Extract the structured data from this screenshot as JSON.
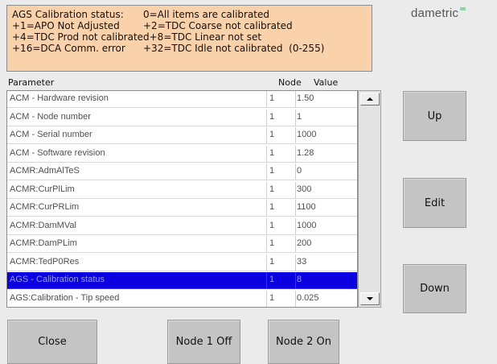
{
  "status_box": {
    "lines": [
      [
        "AGS Calibration status:",
        "0=All items are calibrated"
      ],
      [
        "+1=APO Not Adjusted",
        "+2=TDC Coarse not calibrated"
      ],
      [
        "+4=TDC Prod not calibrated",
        "  +8=TDC Linear not set"
      ],
      [
        "+16=DCA Comm. error",
        "+32=TDC Idle not calibrated  (0-255)"
      ]
    ]
  },
  "logo": {
    "text": "dametric"
  },
  "table": {
    "headers": {
      "parameter": "Parameter",
      "node": "Node",
      "value": "Value"
    },
    "selected_index": 10,
    "rows": [
      {
        "parameter": "ACM - Hardware revision",
        "node": "1",
        "value": "1.50"
      },
      {
        "parameter": "ACM - Node number",
        "node": "1",
        "value": "1"
      },
      {
        "parameter": "ACM - Serial number",
        "node": "1",
        "value": "1000"
      },
      {
        "parameter": "ACM - Software revision",
        "node": "1",
        "value": "1.28"
      },
      {
        "parameter": "ACMR:AdmAlTeS",
        "node": "1",
        "value": "0"
      },
      {
        "parameter": "ACMR:CurPlLim",
        "node": "1",
        "value": "300"
      },
      {
        "parameter": "ACMR:CurPRLim",
        "node": "1",
        "value": "1100"
      },
      {
        "parameter": "ACMR:DamMVal",
        "node": "1",
        "value": "1000"
      },
      {
        "parameter": "ACMR:DamPLim",
        "node": "1",
        "value": "200"
      },
      {
        "parameter": "ACMR:TedP0Res",
        "node": "1",
        "value": "33"
      },
      {
        "parameter": "AGS - Calibration status",
        "node": "1",
        "value": "8"
      },
      {
        "parameter": "AGS:Calibration - Tip speed",
        "node": "1",
        "value": "0.025"
      }
    ]
  },
  "buttons": {
    "up": "Up",
    "edit": "Edit",
    "down": "Down",
    "close": "Close",
    "node1": "Node 1 Off",
    "node2": "Node 2 On"
  },
  "colors": {
    "status_box_bg": "#f9d1ab",
    "selection": "#0a00e0",
    "button_bg": "#c4c4c4"
  }
}
